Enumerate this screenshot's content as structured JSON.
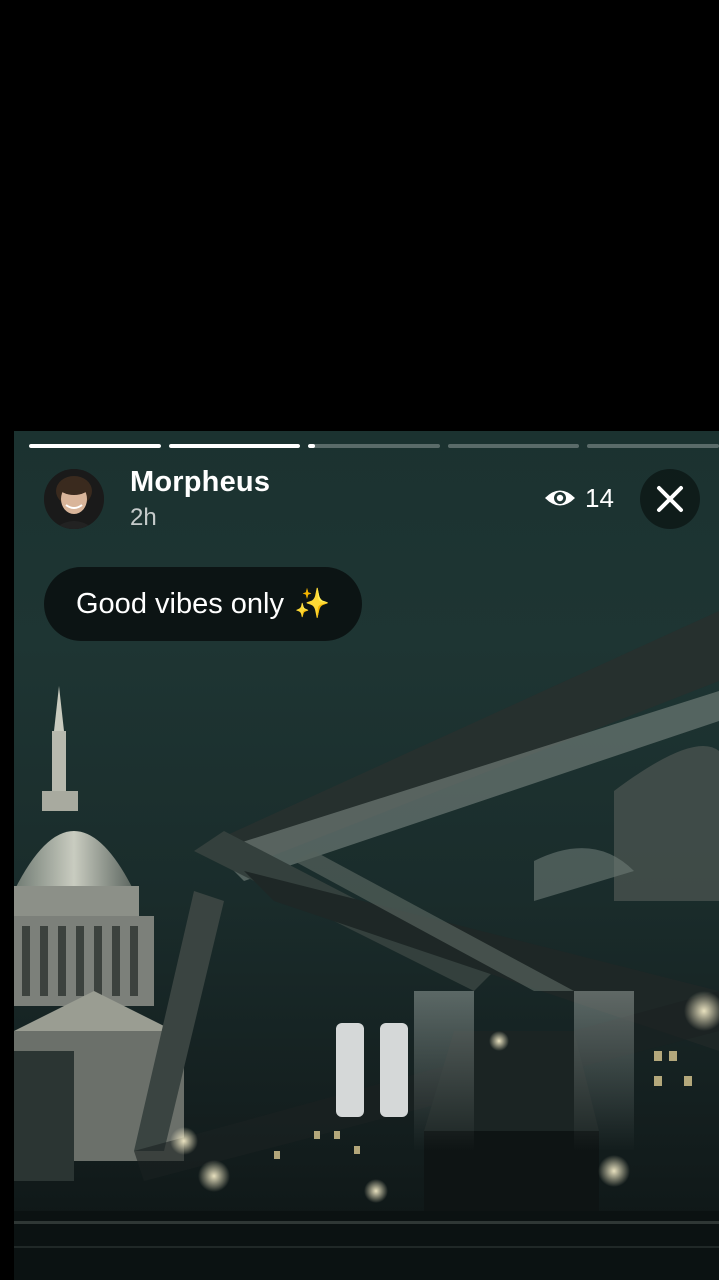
{
  "story": {
    "progress": [
      1.0,
      1.0,
      0.05,
      0.0,
      0.0
    ],
    "user": {
      "name": "Morpheus",
      "time": "2h",
      "avatar": "avatar-photo"
    },
    "views": {
      "icon": "eye-icon",
      "count": "14"
    },
    "close_icon": "close-icon",
    "caption": {
      "text": "Good vibes only",
      "emoji": "✨"
    },
    "pause_icon": "pause-icon",
    "background": "night-city-bridge-photo"
  }
}
